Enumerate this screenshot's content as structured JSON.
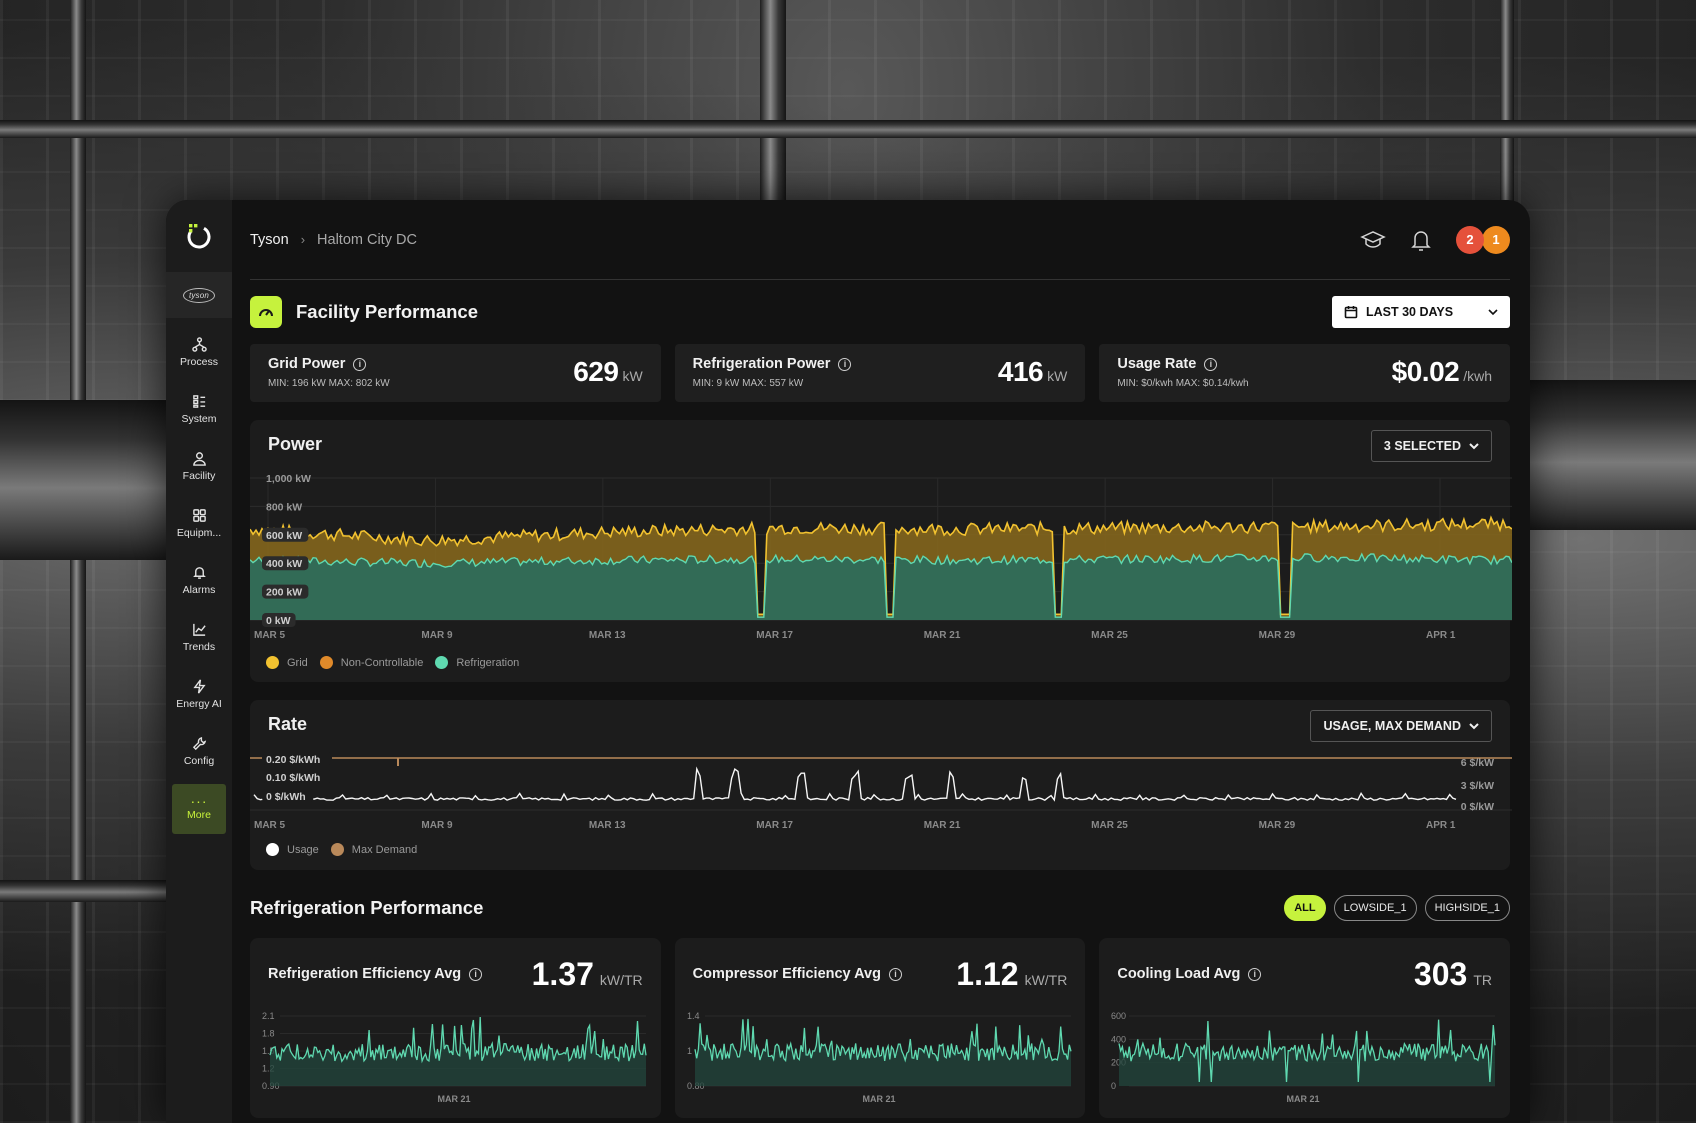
{
  "breadcrumb": {
    "org": "Tyson",
    "site": "Haltom City DC"
  },
  "sidebar": {
    "org_logo": "tyson",
    "items": [
      {
        "label": "Process",
        "icon": "process-icon"
      },
      {
        "label": "System",
        "icon": "system-icon"
      },
      {
        "label": "Facility",
        "icon": "facility-icon"
      },
      {
        "label": "Equipm...",
        "icon": "equipment-icon"
      },
      {
        "label": "Alarms",
        "icon": "bell-icon"
      },
      {
        "label": "Trends",
        "icon": "trends-icon"
      },
      {
        "label": "Energy AI",
        "icon": "bolt-icon"
      },
      {
        "label": "Config",
        "icon": "wrench-icon"
      },
      {
        "label": "More",
        "icon": "more-icon",
        "active": true
      }
    ]
  },
  "header": {
    "notifications": [
      "2",
      "1"
    ]
  },
  "facility": {
    "title": "Facility Performance",
    "date_range": "LAST 30 DAYS",
    "kpis": [
      {
        "name": "Grid Power",
        "range": "MIN: 196 kW MAX: 802 kW",
        "value": "629",
        "unit": "kW"
      },
      {
        "name": "Refrigeration Power",
        "range": "MIN: 9 kW MAX: 557 kW",
        "value": "416",
        "unit": "kW"
      },
      {
        "name": "Usage Rate",
        "range": "MIN: $0/kwh MAX: $0.14/kwh",
        "value": "$0.02",
        "unit": "/kwh"
      }
    ]
  },
  "power": {
    "title": "Power",
    "selector": "3 SELECTED",
    "y_ticks": [
      "1,000 kW",
      "800 kW",
      "600 kW",
      "400 kW",
      "200 kW",
      "0 kW"
    ],
    "x_ticks": [
      "MAR 5",
      "MAR 9",
      "MAR 13",
      "MAR 17",
      "MAR 21",
      "MAR 25",
      "MAR 29",
      "APR 1"
    ],
    "legend": [
      "Grid",
      "Non-Controllable",
      "Refrigeration"
    ]
  },
  "rate": {
    "title": "Rate",
    "selector": "USAGE, MAX DEMAND",
    "y_left": [
      "0.20 $/kWh",
      "0.10 $/kWh",
      "0 $/kWh"
    ],
    "y_right": [
      "6 $/kW",
      "3 $/kW",
      "0 $/kW"
    ],
    "x_ticks": [
      "MAR 5",
      "MAR 9",
      "MAR 13",
      "MAR 17",
      "MAR 21",
      "MAR 25",
      "MAR 29",
      "APR 1"
    ],
    "legend": [
      "Usage",
      "Max Demand"
    ]
  },
  "refrigeration": {
    "title": "Refrigeration Performance",
    "filters": [
      "ALL",
      "LOWSIDE_1",
      "HIGHSIDE_1"
    ],
    "metrics": [
      {
        "name": "Refrigeration Efficiency Avg",
        "value": "1.37",
        "unit": "kW/TR",
        "y_ticks": [
          "2.1",
          "1.8",
          "1.5",
          "1.2",
          "0.90"
        ],
        "x_tick": "MAR 21"
      },
      {
        "name": "Compressor Efficiency Avg",
        "value": "1.12",
        "unit": "kW/TR",
        "y_ticks": [
          "1.4",
          "1",
          "0.80"
        ],
        "x_tick": "MAR 21"
      },
      {
        "name": "Cooling Load Avg",
        "value": "303",
        "unit": "TR",
        "y_ticks": [
          "600",
          "400",
          "200",
          "0"
        ],
        "x_tick": "MAR 21"
      }
    ]
  },
  "colors": {
    "accent": "#c6f23d",
    "grid": "#f2c230",
    "non_controllable": "#d9892a",
    "refrigeration": "#5fd9b0",
    "max_demand": "#b9895a"
  },
  "chart_data": [
    {
      "type": "area",
      "title": "Power",
      "x": [
        "MAR 5",
        "MAR 9",
        "MAR 13",
        "MAR 17",
        "MAR 21",
        "MAR 25",
        "MAR 29",
        "APR 1"
      ],
      "ylim": [
        0,
        1000
      ],
      "series": [
        {
          "name": "Grid",
          "values": [
            640,
            560,
            620,
            650,
            640,
            650,
            660,
            680
          ]
        },
        {
          "name": "Non-Controllable",
          "values": [
            640,
            560,
            620,
            650,
            640,
            650,
            660,
            680
          ]
        },
        {
          "name": "Refrigeration",
          "values": [
            420,
            400,
            420,
            430,
            420,
            430,
            440,
            420
          ]
        }
      ]
    },
    {
      "type": "line",
      "title": "Rate",
      "x": [
        "MAR 5",
        "MAR 9",
        "MAR 13",
        "MAR 17",
        "MAR 21",
        "MAR 25",
        "MAR 29",
        "APR 1"
      ],
      "ylim": [
        0,
        0.2
      ],
      "series": [
        {
          "name": "Usage",
          "values": [
            0.01,
            0.01,
            0.01,
            0.02,
            0.02,
            0.02,
            0.01,
            0.01
          ]
        },
        {
          "name": "Max Demand",
          "values": [
            6,
            6,
            6,
            6,
            6,
            6,
            6,
            6
          ]
        }
      ]
    }
  ]
}
